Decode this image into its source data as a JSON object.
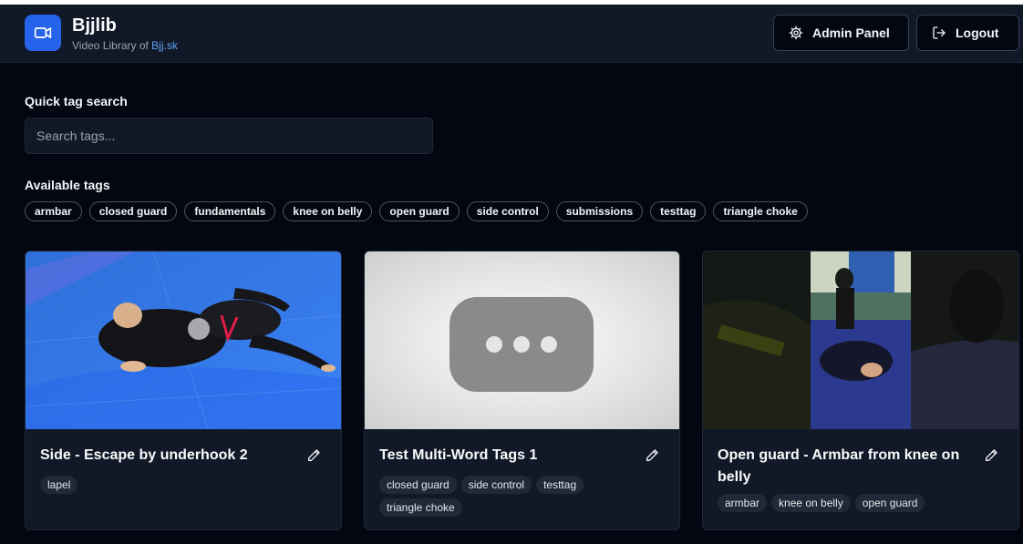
{
  "brand": {
    "title": "Bjjlib",
    "subtitle_prefix": "Video Library of ",
    "subtitle_link": "Bjj.sk",
    "logo_icon": "video-camera-icon",
    "accent_color": "#2563eb"
  },
  "header": {
    "admin_label": "Admin Panel",
    "admin_icon": "gear-icon",
    "logout_label": "Logout",
    "logout_icon": "logout-icon"
  },
  "search": {
    "label": "Quick tag search",
    "placeholder": "Search tags..."
  },
  "available_tags": {
    "label": "Available tags",
    "items": [
      "armbar",
      "closed guard",
      "fundamentals",
      "knee on belly",
      "open guard",
      "side control",
      "submissions",
      "testtag",
      "triangle choke"
    ]
  },
  "videos": [
    {
      "title": "Side - Escape by underhook 2",
      "tags": [
        "lapel"
      ]
    },
    {
      "title": "Test Multi-Word Tags 1",
      "tags": [
        "closed guard",
        "side control",
        "testtag",
        "triangle choke"
      ]
    },
    {
      "title": "Open guard - Armbar from knee on belly",
      "tags": [
        "armbar",
        "knee on belly",
        "open guard"
      ]
    }
  ]
}
